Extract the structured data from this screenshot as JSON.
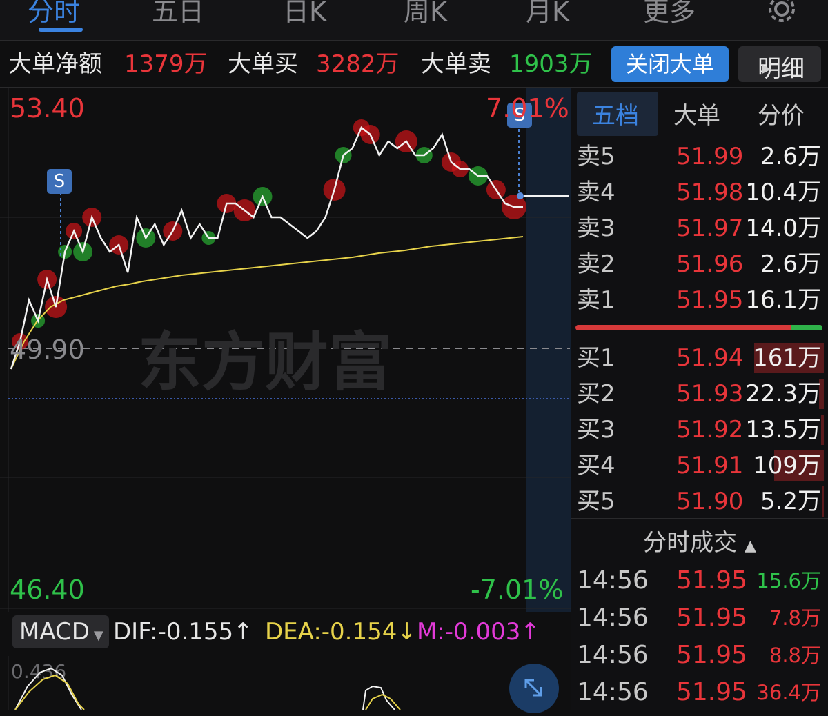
{
  "tabs": [
    {
      "label": "分时",
      "active": true
    },
    {
      "label": "五日"
    },
    {
      "label": "日K"
    },
    {
      "label": "周K"
    },
    {
      "label": "月K"
    },
    {
      "label": "更多"
    }
  ],
  "settings_icon": "gear-icon",
  "big_order": {
    "net_label": "大单净额",
    "net_value": "1379万",
    "buy_label": "大单买",
    "buy_value": "3282万",
    "sell_label": "大单卖",
    "sell_value": "1903万",
    "close_button": "关闭大单",
    "detail_button": "明细"
  },
  "chart": {
    "high_price": "53.40",
    "prev_close": "49.90",
    "low_price": "46.40",
    "high_pct": "7.01%",
    "low_pct": "-7.01%",
    "watermark": "东方财富",
    "marker_label": "S"
  },
  "chart_data": {
    "type": "line",
    "ylim": [
      46.4,
      53.4
    ],
    "prev_close": 49.9,
    "series": [
      {
        "values": [
          49.6,
          50.0,
          50.6,
          50.3,
          50.9,
          50.5,
          51.3,
          51.6,
          51.3,
          51.8,
          51.5,
          51.3,
          51.4,
          51.0,
          51.8,
          51.5,
          51.7,
          51.4,
          51.6,
          51.9,
          51.5,
          51.7,
          51.5,
          51.5,
          52.0,
          52.0,
          51.9,
          51.8,
          52.1,
          51.8,
          51.8,
          51.7,
          51.6,
          51.5,
          51.6,
          51.8,
          52.2,
          52.7,
          52.8,
          53.1,
          53.0,
          52.7,
          52.9,
          52.8,
          52.9,
          52.7,
          52.7,
          52.8,
          53.0,
          52.6,
          52.5,
          52.5,
          52.4,
          52.4,
          52.2,
          52.0,
          51.95,
          51.95
        ]
      },
      {
        "values": [
          49.6,
          50.0,
          50.3,
          50.5,
          50.6,
          50.65,
          50.7,
          50.75,
          50.8,
          50.83,
          50.87,
          50.9,
          50.93,
          50.96,
          50.98,
          51.0,
          51.02,
          51.04,
          51.06,
          51.08,
          51.1,
          51.12,
          51.14,
          51.16,
          51.18,
          51.2,
          51.22,
          51.25,
          51.28,
          51.3,
          51.32,
          51.35,
          51.38,
          51.4,
          51.42,
          51.44,
          51.46,
          51.48,
          51.5,
          51.52
        ]
      }
    ]
  },
  "macd": {
    "selector": "MACD",
    "dif": "DIF:-0.155↑",
    "dea": "DEA:-0.154↓",
    "m": "M:-0.003↑",
    "axis_top": "0.436"
  },
  "right_panel": {
    "tabs": [
      "五档",
      "大单",
      "分价"
    ],
    "asks": [
      {
        "label": "卖5",
        "price": "51.99",
        "vol": "2.6万"
      },
      {
        "label": "卖4",
        "price": "51.98",
        "vol": "10.4万"
      },
      {
        "label": "卖3",
        "price": "51.97",
        "vol": "14.0万"
      },
      {
        "label": "卖2",
        "price": "51.96",
        "vol": "2.6万"
      },
      {
        "label": "卖1",
        "price": "51.95",
        "vol": "16.1万"
      }
    ],
    "bids": [
      {
        "label": "买1",
        "price": "51.94",
        "vol": "161万",
        "level": 0.84
      },
      {
        "label": "买2",
        "price": "51.93",
        "vol": "22.3万",
        "level": 0.06
      },
      {
        "label": "买3",
        "price": "51.92",
        "vol": "13.5万",
        "level": 0.03
      },
      {
        "label": "买4",
        "price": "51.91",
        "vol": "109万",
        "level": 0.6
      },
      {
        "label": "买5",
        "price": "51.90",
        "vol": "5.2万",
        "level": 0.02
      }
    ],
    "ticks_header": "分时成交",
    "ticks": [
      {
        "time": "14:56",
        "price": "51.95",
        "vol": "15.6万",
        "dir": "green"
      },
      {
        "time": "14:56",
        "price": "51.95",
        "vol": "7.8万",
        "dir": "red"
      },
      {
        "time": "14:56",
        "price": "51.95",
        "vol": "8.8万",
        "dir": "red"
      },
      {
        "time": "14:56",
        "price": "51.95",
        "vol": "36.4万",
        "dir": "red"
      }
    ]
  },
  "colors": {
    "up": "#e8353a",
    "down": "#2fc14a",
    "accent": "#2f7ed8",
    "avg_line": "#e6d24a",
    "price_line": "#f2f2f2"
  }
}
